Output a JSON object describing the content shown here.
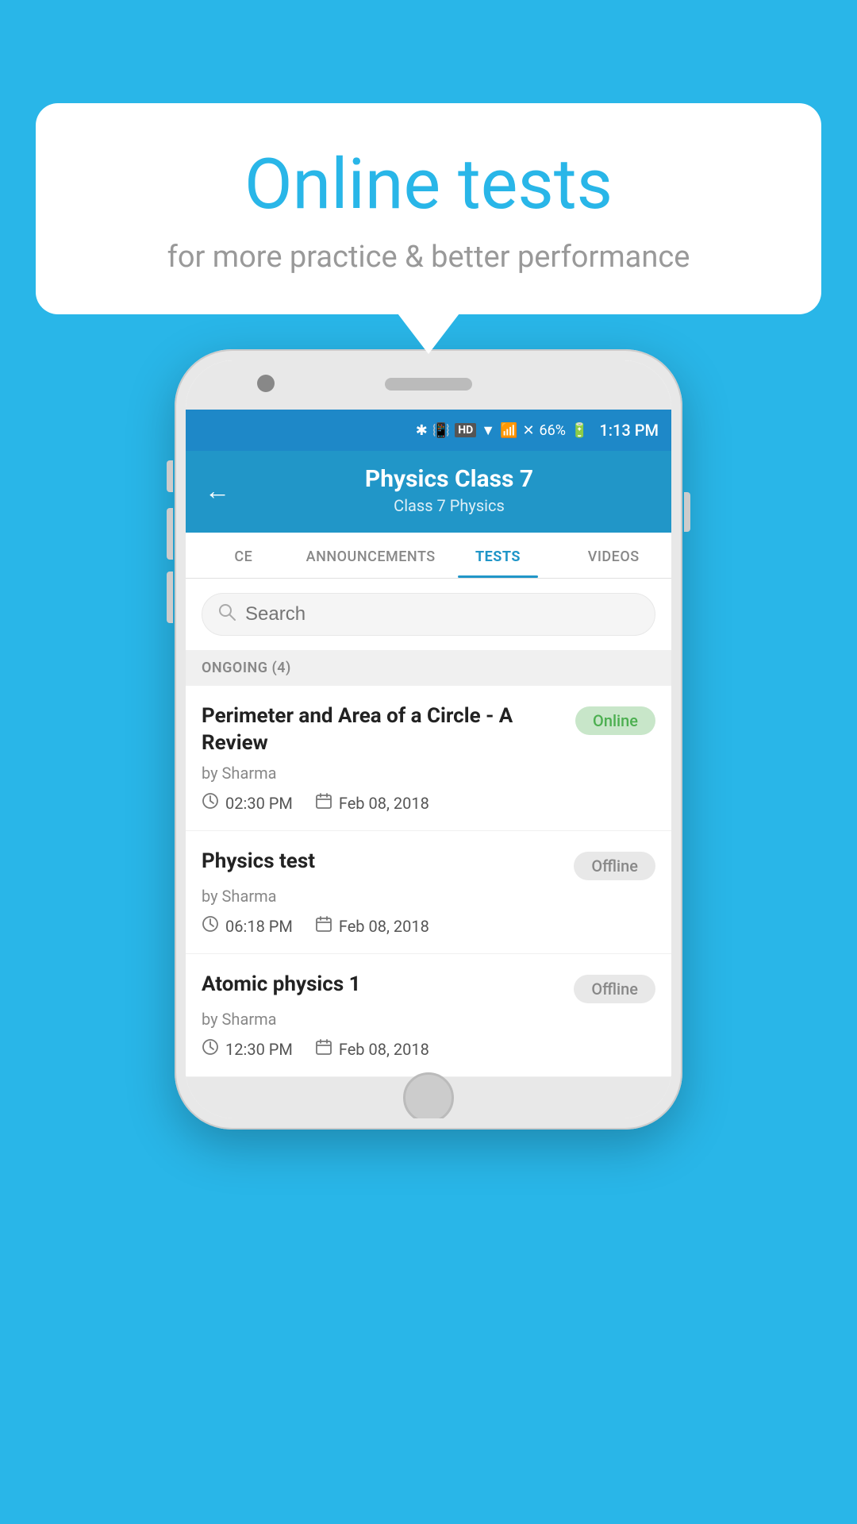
{
  "bubble": {
    "title": "Online tests",
    "subtitle": "for more practice & better performance"
  },
  "status_bar": {
    "battery": "66%",
    "time": "1:13 PM"
  },
  "header": {
    "title": "Physics Class 7",
    "breadcrumb": "Class 7   Physics",
    "back_label": "←"
  },
  "tabs": [
    {
      "id": "ce",
      "label": "CE",
      "active": false
    },
    {
      "id": "announcements",
      "label": "ANNOUNCEMENTS",
      "active": false
    },
    {
      "id": "tests",
      "label": "TESTS",
      "active": true
    },
    {
      "id": "videos",
      "label": "VIDEOS",
      "active": false
    }
  ],
  "search": {
    "placeholder": "Search"
  },
  "section": {
    "label": "ONGOING (4)"
  },
  "tests": [
    {
      "name": "Perimeter and Area of a Circle - A Review",
      "by": "by Sharma",
      "time": "02:30 PM",
      "date": "Feb 08, 2018",
      "status": "Online",
      "status_type": "online"
    },
    {
      "name": "Physics test",
      "by": "by Sharma",
      "time": "06:18 PM",
      "date": "Feb 08, 2018",
      "status": "Offline",
      "status_type": "offline"
    },
    {
      "name": "Atomic physics 1",
      "by": "by Sharma",
      "time": "12:30 PM",
      "date": "Feb 08, 2018",
      "status": "Offline",
      "status_type": "offline"
    }
  ]
}
